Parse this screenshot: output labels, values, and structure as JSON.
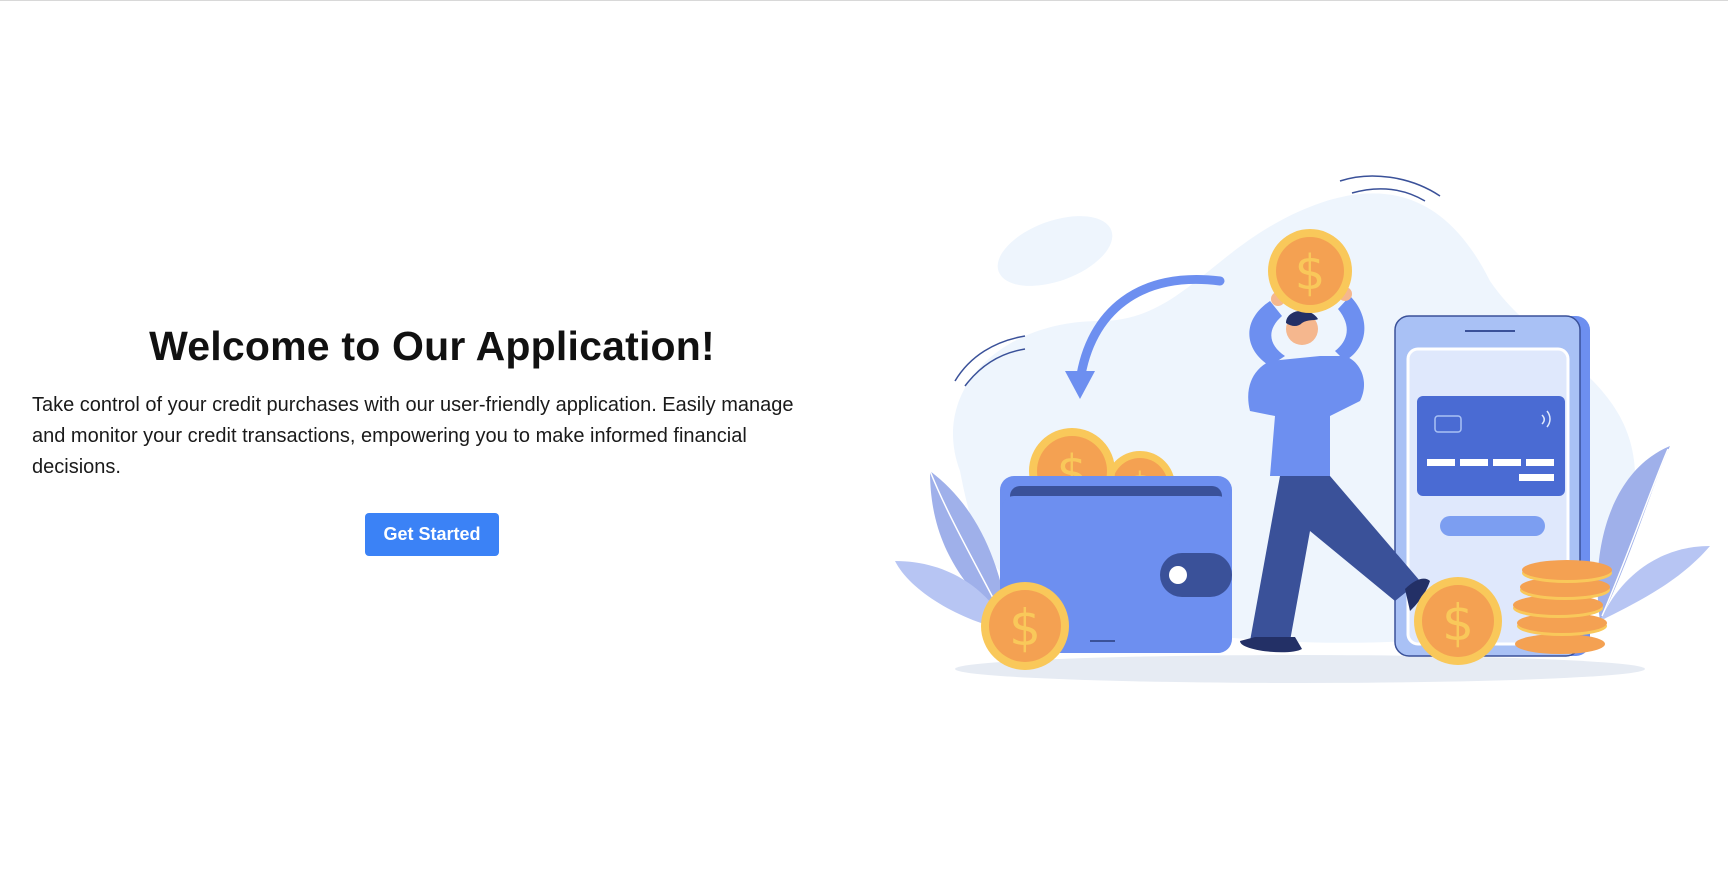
{
  "hero": {
    "title": "Welcome to Our Application!",
    "description": "Take control of your credit purchases with our user-friendly application. Easily manage and monitor your credit transactions, empowering you to make informed financial decisions.",
    "cta_label": "Get Started"
  },
  "illustration": {
    "coin_symbol": "$",
    "icons": [
      "wallet-icon",
      "coin-icon",
      "phone-icon",
      "credit-card-icon",
      "arrow-icon",
      "leaf-icon",
      "person-icon"
    ]
  },
  "colors": {
    "accent": "#3b82f6",
    "wallet": "#6d8ff0",
    "coin": "#f4a152",
    "coin_rim": "#f9c85a",
    "navy": "#3a5199",
    "phone": "#a9c1f5"
  }
}
